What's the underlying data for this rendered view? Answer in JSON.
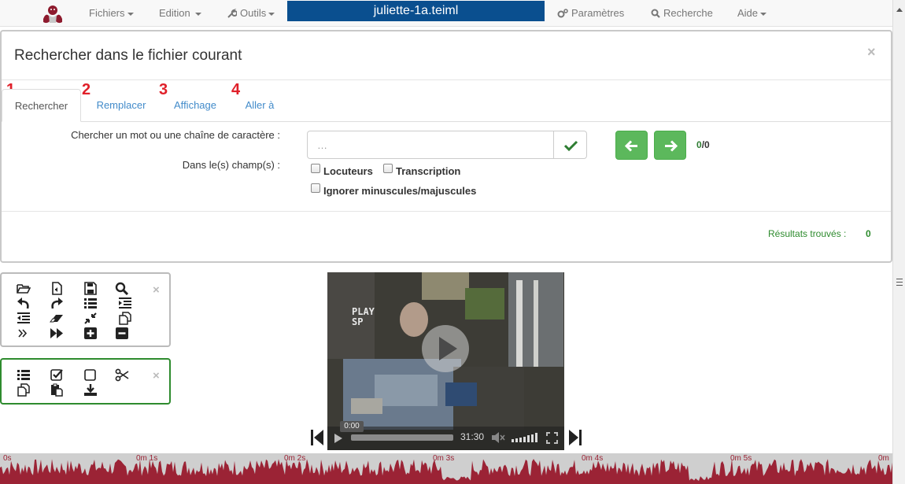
{
  "navbar": {
    "logo_icon": "hands-logo-icon",
    "menu_files": "Fichiers",
    "menu_edit": "Edition",
    "menu_tools": "Outils",
    "filename": "juliette-1a.teiml",
    "menu_settings": "Paramètres",
    "menu_search": "Recherche",
    "menu_help": "Aide"
  },
  "dialog": {
    "title": "Rechercher dans le fichier courant",
    "close": "×",
    "tabs": [
      {
        "num": "1",
        "label": "Rechercher",
        "active": true
      },
      {
        "num": "2",
        "label": "Remplacer",
        "active": false
      },
      {
        "num": "3",
        "label": "Affichage",
        "active": false
      },
      {
        "num": "4",
        "label": "Aller à",
        "active": false
      }
    ],
    "search_label": "Chercher un mot ou une chaîne de caractère :",
    "search_placeholder": "…",
    "search_value": "",
    "fields_label": "Dans le(s) champ(s) :",
    "checkboxes": [
      {
        "label": "Locuteurs",
        "checked": false
      },
      {
        "label": "Transcription",
        "checked": false
      },
      {
        "label": "Ignorer minuscules/majuscules",
        "checked": false
      }
    ],
    "counter_current": "0",
    "counter_total": "/0",
    "results_label": "Résultats trouvés :",
    "results_count": "0",
    "accent_green": "#5cb85c"
  },
  "toolbar_main": {
    "icons": [
      "folder-open-icon",
      "audio-file-icon",
      "save-icon",
      "search-icon",
      "undo-icon",
      "redo-icon",
      "list-icon",
      "indent-icon",
      "outdent-icon",
      "eraser-icon",
      "compress-icon",
      "copy-icon",
      "double-chevron-right-icon",
      "fast-forward-icon",
      "plus-square-icon",
      "minus-square-icon"
    ],
    "close": "×"
  },
  "toolbar_selection": {
    "icons": [
      "list-icon",
      "checkbox-checked-icon",
      "checkbox-empty-icon",
      "scissors-icon",
      "copy-icon",
      "paste-icon",
      "download-icon"
    ],
    "close": "×"
  },
  "video": {
    "overlay_line1": "PLAY",
    "overlay_line2": "SP",
    "current_time": "0:00",
    "duration": "31:30"
  },
  "waveform": {
    "ticks": [
      "0s",
      "0m 1s",
      "0m 2s",
      "0m 3s",
      "0m 4s",
      "0m 5s",
      "0m"
    ],
    "color": "#9b2335"
  }
}
